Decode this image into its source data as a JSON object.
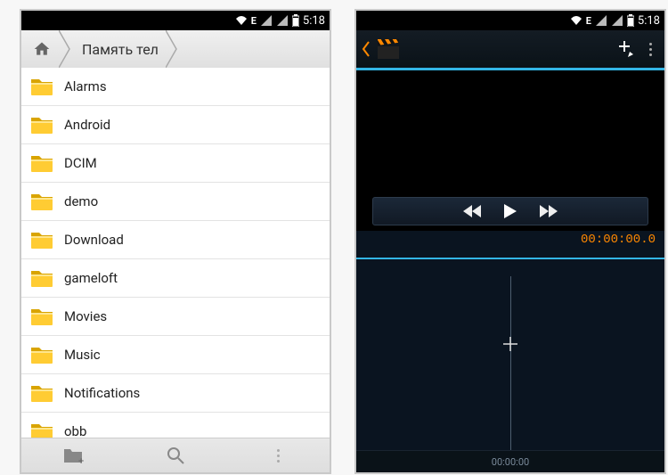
{
  "status": {
    "network": "E",
    "time": "5:18"
  },
  "left": {
    "breadcrumb": {
      "location": "Память тел"
    },
    "folders": [
      {
        "name": "Alarms"
      },
      {
        "name": "Android"
      },
      {
        "name": "DCIM"
      },
      {
        "name": "demo"
      },
      {
        "name": "Download"
      },
      {
        "name": "gameloft"
      },
      {
        "name": "Movies"
      },
      {
        "name": "Music"
      },
      {
        "name": "Notifications"
      },
      {
        "name": "obb"
      }
    ]
  },
  "right": {
    "timecode": "00:00:00.0",
    "ruler": "00:00:00"
  }
}
